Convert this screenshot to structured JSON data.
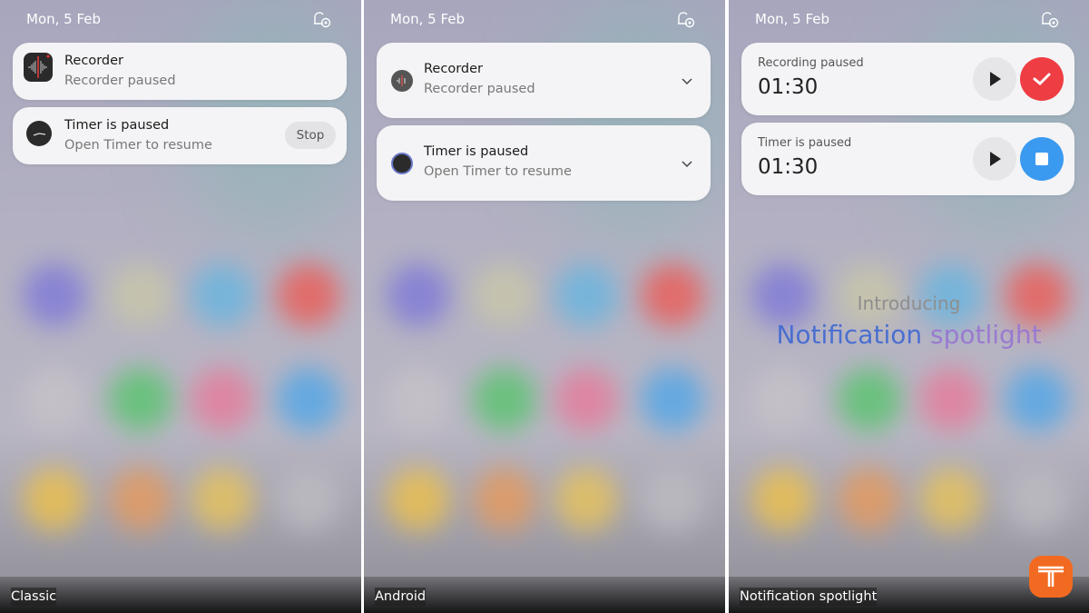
{
  "date": "Mon, 5 Feb",
  "panels": [
    {
      "label": "Classic",
      "notifications": [
        {
          "title": "Recorder",
          "text": "Recorder paused",
          "icon": "recorder-icon"
        },
        {
          "title": "Timer is paused",
          "text": "Open Timer to resume",
          "icon": "clock-icon",
          "action": "Stop"
        }
      ]
    },
    {
      "label": "Android",
      "notifications": [
        {
          "title": "Recorder",
          "text": "Recorder paused",
          "icon": "recorder-icon"
        },
        {
          "title": "Timer is paused",
          "text": "Open Timer to resume",
          "icon": "clock-icon"
        }
      ]
    },
    {
      "label": "Notification spotlight",
      "notifications": [
        {
          "title": "Recording paused",
          "time": "01:30",
          "primary_color": "#ee3d43",
          "primary_icon": "check-icon"
        },
        {
          "title": "Timer is paused",
          "time": "01:30",
          "primary_color": "#3a9af0",
          "primary_icon": "stop-icon"
        }
      ],
      "intro": "Introducing",
      "headline_1": "Notification",
      "headline_2": "spotlight"
    }
  ],
  "colors": {
    "brand_logo": "#f26a21",
    "headline_blue": "#4a6fd0",
    "headline_purple": "#9a7ad0"
  }
}
